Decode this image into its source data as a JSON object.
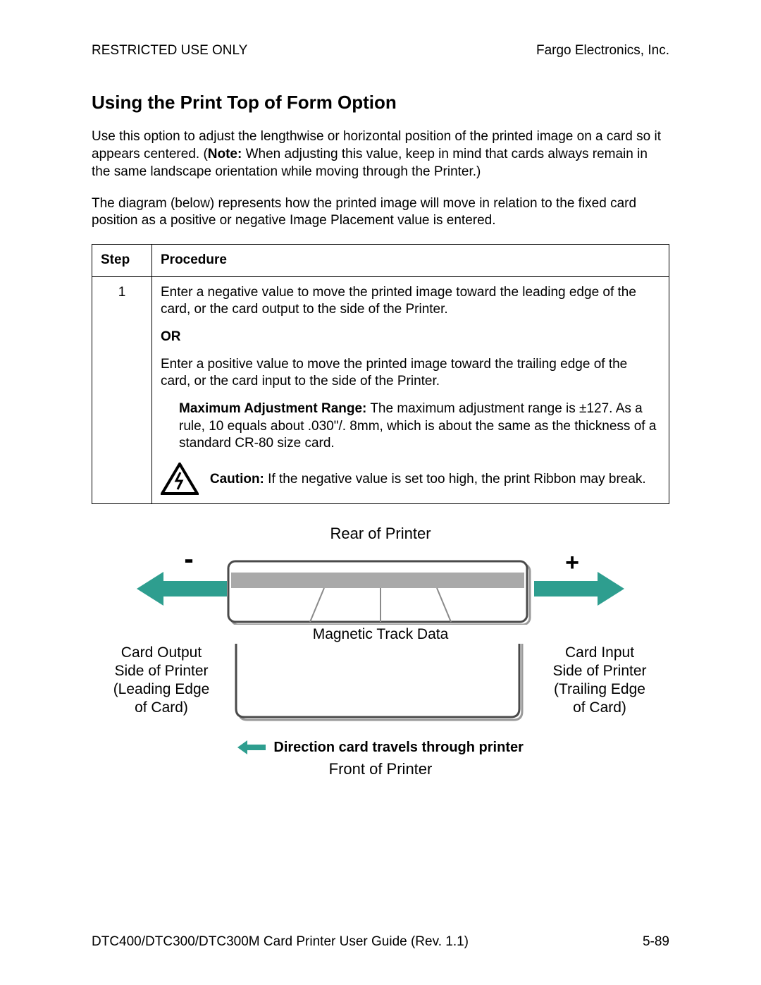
{
  "header": {
    "left": "RESTRICTED USE ONLY",
    "right": "Fargo Electronics, Inc."
  },
  "title": "Using the Print Top of Form Option",
  "intro": {
    "p1a": "Use this option to adjust the lengthwise or horizontal position of the printed image on a card so it appears centered. (",
    "note_label": "Note:",
    "p1b": "  When adjusting this value, keep in mind that cards always remain in the same landscape orientation while moving through the Printer.)",
    "p2": "The diagram (below) represents how the printed image will move in relation to the fixed card position as a positive or negative Image Placement value is entered."
  },
  "table": {
    "col1": "Step",
    "col2": "Procedure",
    "step": "1",
    "proc": {
      "neg": "Enter a negative value to move the printed image toward the leading edge of the card, or the card output to the side of the Printer.",
      "or": "OR",
      "pos": "Enter a positive value to move the printed image toward the trailing edge of the card, or the card input to the side of the Printer.",
      "range_label": "Maximum Adjustment Range:",
      "range_text": "  The maximum adjustment range is ±127. As a rule, 10 equals about .030\"/. 8mm, which is about the same as the thickness of a standard CR-80 size card.",
      "caution_label": "Caution:",
      "caution_text": "  If the negative value is set too high, the print Ribbon may break."
    }
  },
  "diagram": {
    "rear": "Rear of Printer",
    "minus": "-",
    "plus": "+",
    "mag": "Magnetic Track Data",
    "left1": "Card Output",
    "left2": "Side of Printer",
    "left3": "(Leading Edge",
    "left4": "of Card)",
    "right1": "Card Input",
    "right2": "Side of Printer",
    "right3": "(Trailing Edge",
    "right4": "of Card)",
    "dir": "Direction card travels through printer",
    "front": "Front of Printer"
  },
  "footer": {
    "left": "DTC400/DTC300/DTC300M Card Printer User Guide (Rev. 1.1)",
    "right": "5-89"
  }
}
